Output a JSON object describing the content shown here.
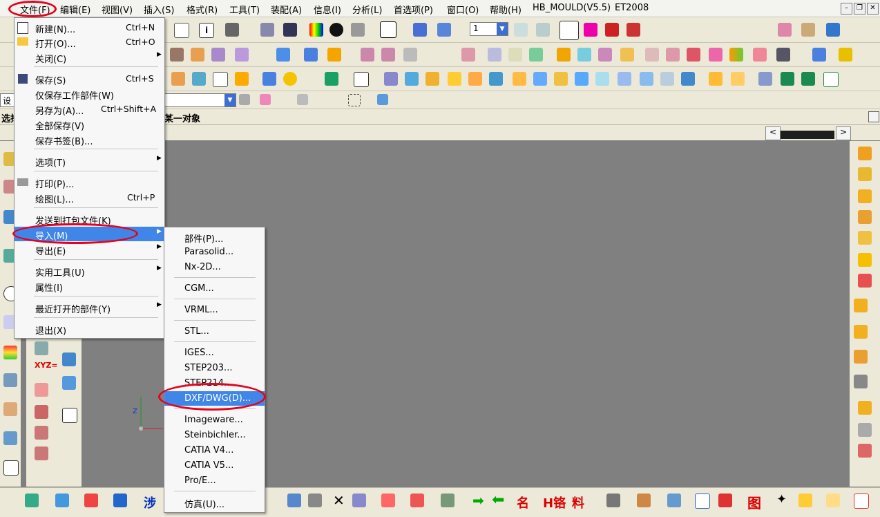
{
  "menubar": {
    "items": [
      "文件(F)",
      "编辑(E)",
      "视图(V)",
      "插入(S)",
      "格式(R)",
      "工具(T)",
      "装配(A)",
      "信息(I)",
      "分析(L)",
      "首选项(P)",
      "窗口(O)",
      "帮助(H)",
      "HB_MOULD(V5.5)",
      "ET2008"
    ]
  },
  "toolbar": {
    "layer_value": "1",
    "filter_value": "设",
    "cue_prefix": "选择",
    "cue_text": "某一对象"
  },
  "file_menu": {
    "items": [
      {
        "label": "新建(N)...",
        "shortcut": "Ctrl+N"
      },
      {
        "label": "打开(O)...",
        "shortcut": "Ctrl+O"
      },
      {
        "label": "关闭(C)",
        "submenu": true
      },
      {
        "label": "保存(S)",
        "shortcut": "Ctrl+S"
      },
      {
        "label": "仅保存工作部件(W)"
      },
      {
        "label": "另存为(A)...",
        "shortcut": "Ctrl+Shift+A"
      },
      {
        "label": "全部保存(V)"
      },
      {
        "label": "保存书签(B)..."
      },
      {
        "label": "选项(T)",
        "submenu": true
      },
      {
        "label": "打印(P)..."
      },
      {
        "label": "绘图(L)...",
        "shortcut": "Ctrl+P"
      },
      {
        "label": "发送到打包文件(K)"
      },
      {
        "label": "导入(M)",
        "submenu": true,
        "highlighted": true
      },
      {
        "label": "导出(E)",
        "submenu": true
      },
      {
        "label": "实用工具(U)",
        "submenu": true
      },
      {
        "label": "属性(I)"
      },
      {
        "label": "最近打开的部件(Y)",
        "submenu": true
      },
      {
        "label": "退出(X)"
      }
    ]
  },
  "import_menu": {
    "items": [
      {
        "label": "部件(P)..."
      },
      {
        "label": "Parasolid..."
      },
      {
        "label": "Nx-2D..."
      },
      {
        "label": "CGM..."
      },
      {
        "label": "VRML..."
      },
      {
        "label": "STL..."
      },
      {
        "label": "IGES..."
      },
      {
        "label": "STEP203..."
      },
      {
        "label": "STEP214..."
      },
      {
        "label": "DXF/DWG(D)...",
        "highlighted": true
      },
      {
        "label": "Imageware..."
      },
      {
        "label": "Steinbichler..."
      },
      {
        "label": "CATIA V4..."
      },
      {
        "label": "CATIA V5..."
      },
      {
        "label": "Pro/E..."
      },
      {
        "label": "仿真(U)..."
      }
    ]
  },
  "left_toolbar": {
    "xyz_label": "XYZ="
  },
  "triad": {
    "z_label": "Z"
  },
  "bottom_toolbar": {
    "ming": "名",
    "hg": "H铬",
    "liao": "料",
    "tu": "图",
    "she": "涉"
  },
  "colors": {
    "highlight": "#3f86e8",
    "annotation": "#e8001c",
    "background": "#808080"
  }
}
